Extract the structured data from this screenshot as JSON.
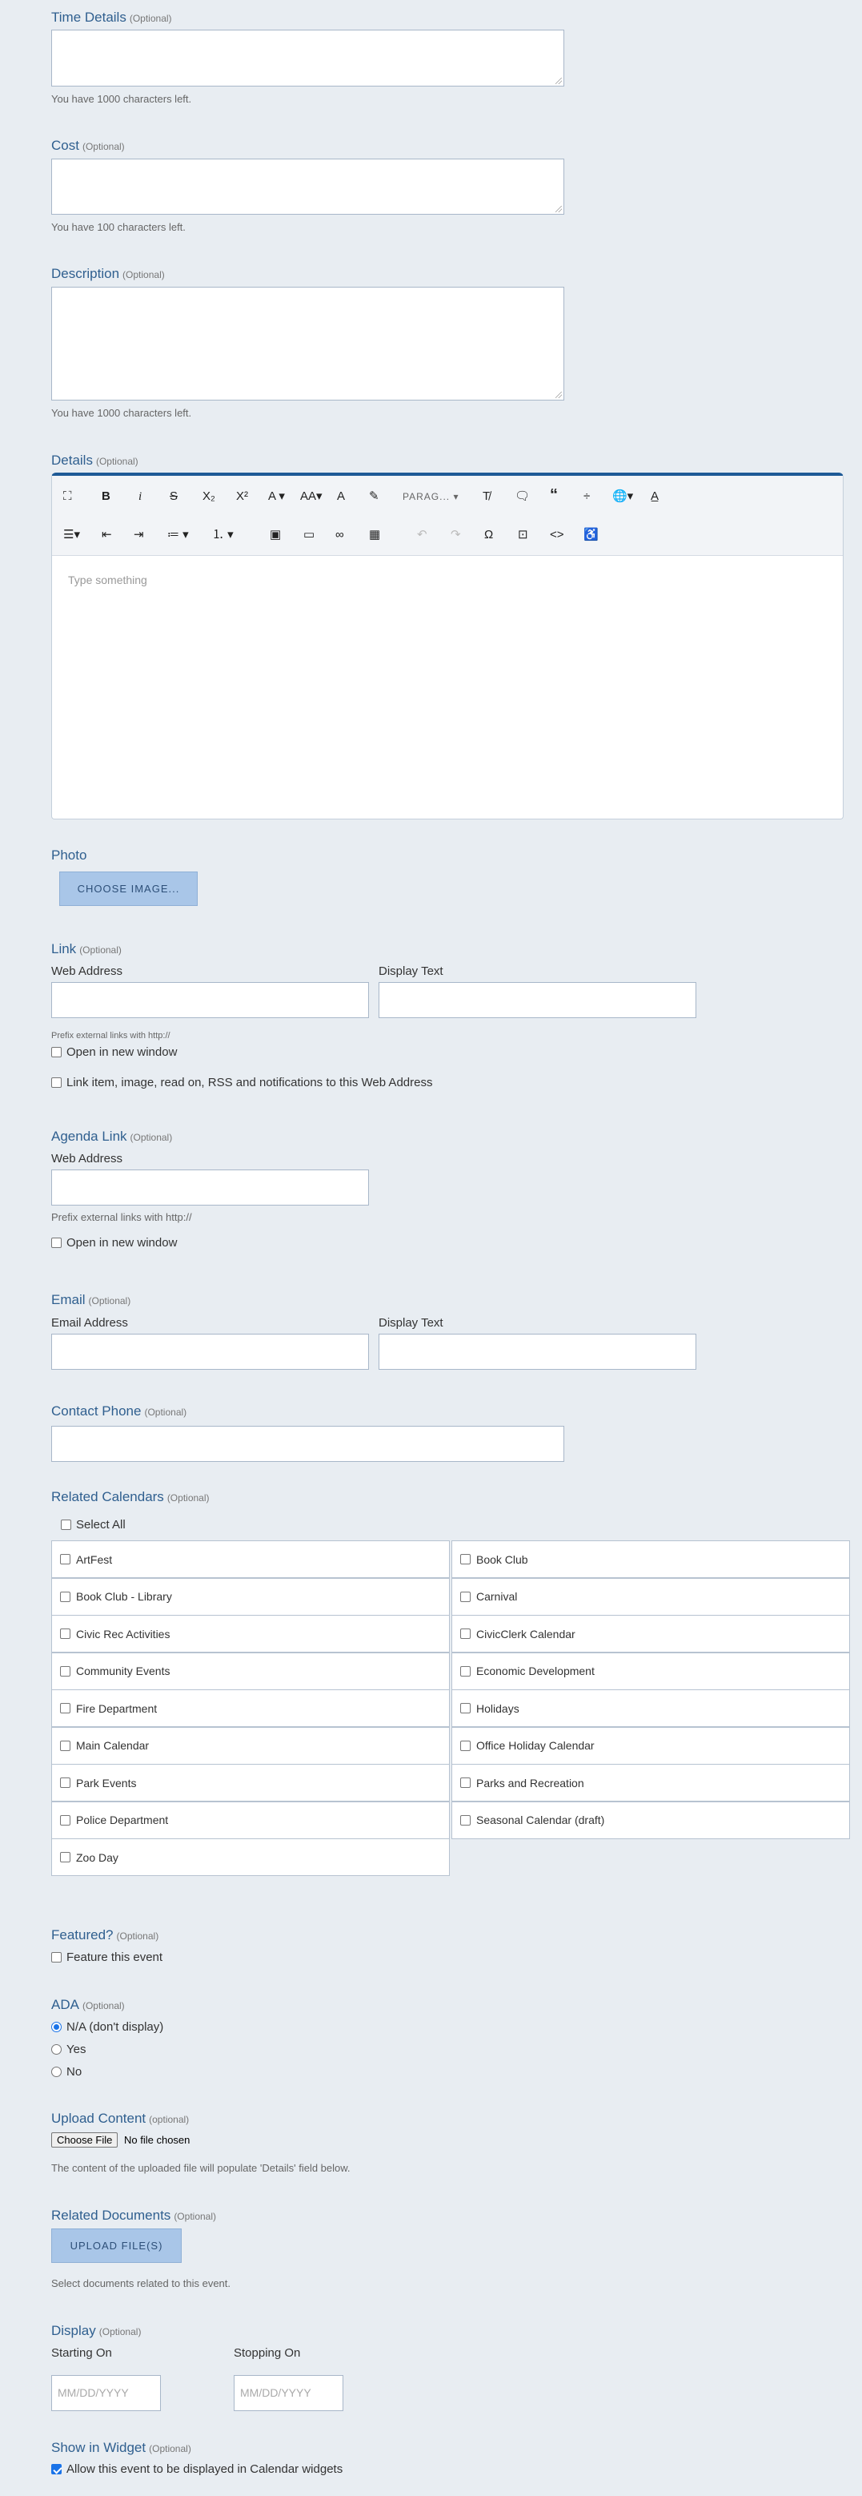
{
  "time_details": {
    "title": "Time Details",
    "optional": "(Optional)",
    "help": "You have 1000 characters left."
  },
  "cost": {
    "title": "Cost",
    "optional": "(Optional)",
    "help": "You have 100 characters left."
  },
  "description": {
    "title": "Description",
    "optional": "(Optional)",
    "help": "You have 1000 characters left."
  },
  "details": {
    "title": "Details",
    "optional": "(Optional)",
    "paragraph_label": "PARAG...",
    "placeholder": "Type something",
    "icons": [
      "fullscreen-icon",
      "bold-icon",
      "italic-icon",
      "strikethrough-icon",
      "subscript-icon",
      "superscript-icon",
      "font-color-icon",
      "font-size-icon",
      "text-color-icon",
      "highlight-icon",
      "paragraph-format-dropdown",
      "clear-formatting-icon",
      "comment-icon",
      "quote-icon",
      "horizontal-line-icon",
      "link-globe-icon",
      "spell-check-icon",
      "align-icon",
      "outdent-icon",
      "indent-icon",
      "unordered-list-icon",
      "ordered-list-icon",
      "image-icon",
      "folder-icon",
      "link-icon",
      "table-icon",
      "undo-icon",
      "redo-icon",
      "special-characters-icon",
      "select-all-icon",
      "code-view-icon",
      "accessibility-icon"
    ]
  },
  "photo": {
    "title": "Photo",
    "button": "CHOOSE IMAGE..."
  },
  "link": {
    "title": "Link",
    "optional": "(Optional)",
    "web_address_label": "Web Address",
    "display_text_label": "Display Text",
    "help": "Prefix external links with http://",
    "open_new_window": "Open in new window",
    "link_item": "Link item, image, read on, RSS and notifications to this Web Address"
  },
  "agenda_link": {
    "title": "Agenda Link",
    "optional": "(Optional)",
    "web_address_label": "Web Address",
    "help": "Prefix external links with http://",
    "open_new_window": "Open in new window"
  },
  "email": {
    "title": "Email",
    "optional": "(Optional)",
    "address_label": "Email Address",
    "display_text_label": "Display Text"
  },
  "contact_phone": {
    "title": "Contact Phone",
    "optional": "(Optional)"
  },
  "related_calendars": {
    "title": "Related Calendars",
    "optional": "(Optional)",
    "select_all": "Select All",
    "items": [
      "ArtFest",
      "Book Club",
      "Book Club - Library",
      "Carnival",
      "Civic Rec Activities",
      "CivicClerk Calendar",
      "Community Events",
      "Economic Development",
      "Fire Department",
      "Holidays",
      "Main Calendar",
      "Office Holiday Calendar",
      "Park Events",
      "Parks and Recreation",
      "Police Department",
      "Seasonal Calendar (draft)",
      "Zoo Day"
    ]
  },
  "featured": {
    "title": "Featured?",
    "optional": "(Optional)",
    "option": "Feature this event"
  },
  "ada": {
    "title": "ADA",
    "optional": "(Optional)",
    "options": [
      "N/A (don't display)",
      "Yes",
      "No"
    ],
    "selected": "N/A (don't display)"
  },
  "upload_content": {
    "title": "Upload Content",
    "optional": "(optional)",
    "choose_file": "Choose File",
    "no_file": "No file chosen",
    "help": "The content of the uploaded file will populate 'Details' field below."
  },
  "related_documents": {
    "title": "Related Documents",
    "optional": "(Optional)",
    "button": "UPLOAD FILE(S)",
    "help": "Select documents related to this event."
  },
  "display": {
    "title": "Display",
    "optional": "(Optional)",
    "starting_label": "Starting On",
    "stopping_label": "Stopping On",
    "date_placeholder": "MM/DD/YYYY"
  },
  "show_in_widget": {
    "title": "Show in Widget",
    "optional": "(Optional)",
    "option": "Allow this event to be displayed in Calendar widgets",
    "checked": true
  },
  "colors": {
    "accent": "#2f5f8f",
    "editor_border": "#1e5a96",
    "button_bg": "#a9c6e8",
    "page_bg": "#e8edf2"
  }
}
